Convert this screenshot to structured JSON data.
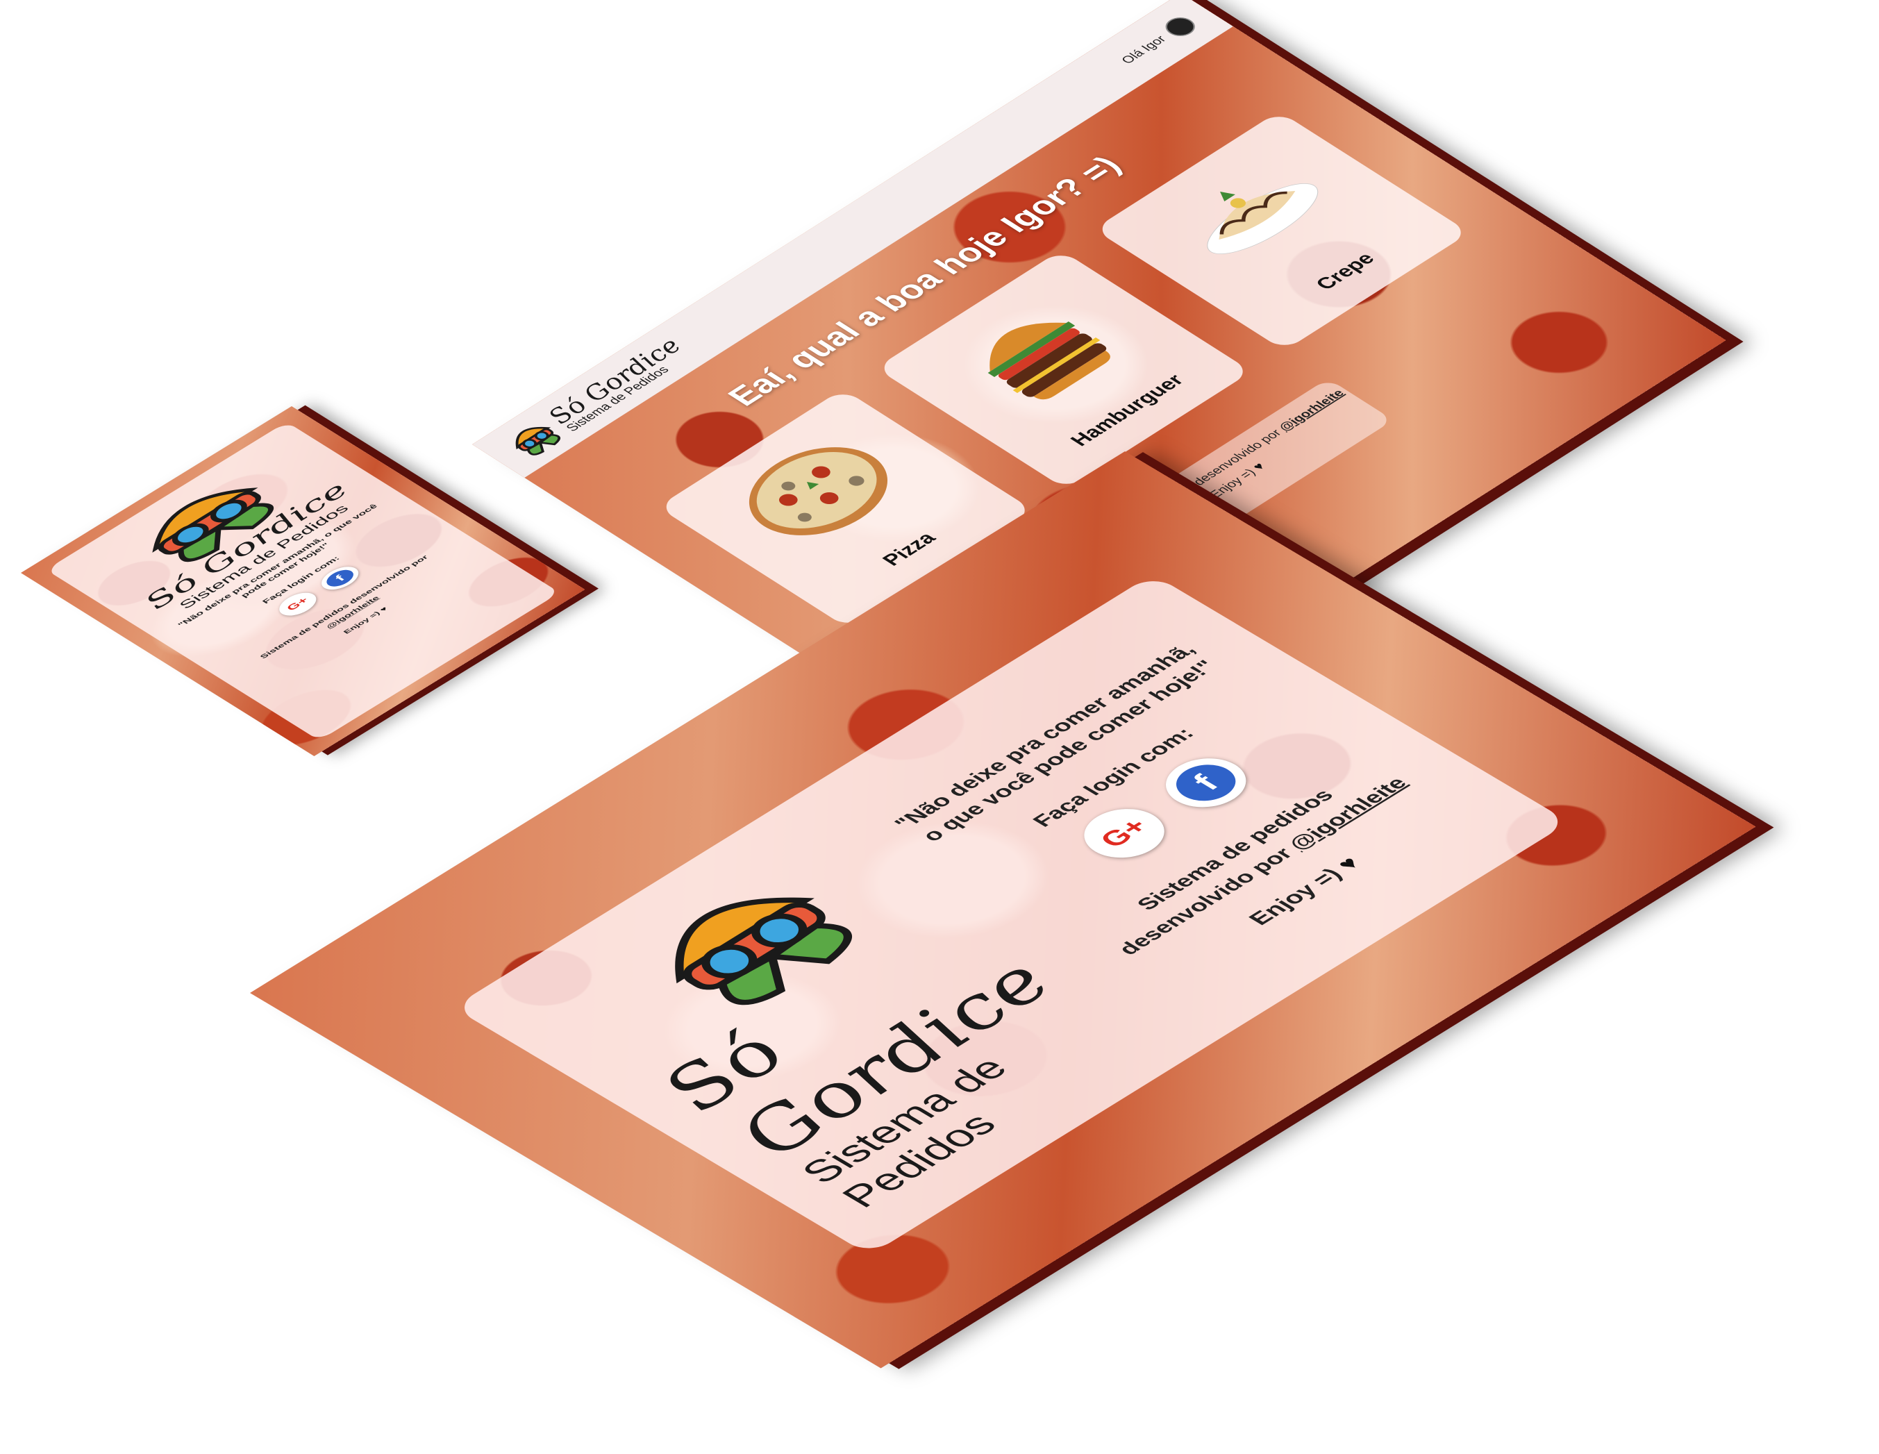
{
  "brand": {
    "name": "Só Gordice",
    "subtitle": "Sistema de Pedidos",
    "colors": {
      "bun": "#f0a020",
      "lettuce": "#5aa845",
      "glasses": "#3da6e0",
      "outline": "#1a1a1a"
    }
  },
  "dashboard": {
    "user_greeting": "Olá Igor",
    "headline": "Eaí, qual a boa hoje Igor? =)",
    "cards": [
      {
        "label": "Pizza",
        "icon": "pizza-icon"
      },
      {
        "label": "Hamburguer",
        "icon": "hamburger-icon"
      },
      {
        "label": "Crepe",
        "icon": "crepe-icon"
      }
    ],
    "footer": {
      "text": "Sistema de pedidos desenvolvido por",
      "handle": "@igorhleite",
      "enjoy": "Enjoy =)"
    }
  },
  "login": {
    "quote": "\"Não deixe pra comer amanhã, o que você pode comer hoje!\"",
    "login_prompt": "Faça login com:",
    "google_label": "G+",
    "facebook_label": "f",
    "dev_text": "Sistema de pedidos desenvolvido por",
    "handle": "@igorhleite",
    "enjoy": "Enjoy =)",
    "heart": "♥"
  },
  "colors": {
    "pizza_red": "#c23b20",
    "panel": "#fff0f0",
    "google_red": "#e02b21",
    "facebook_blue": "#2f62c9"
  }
}
